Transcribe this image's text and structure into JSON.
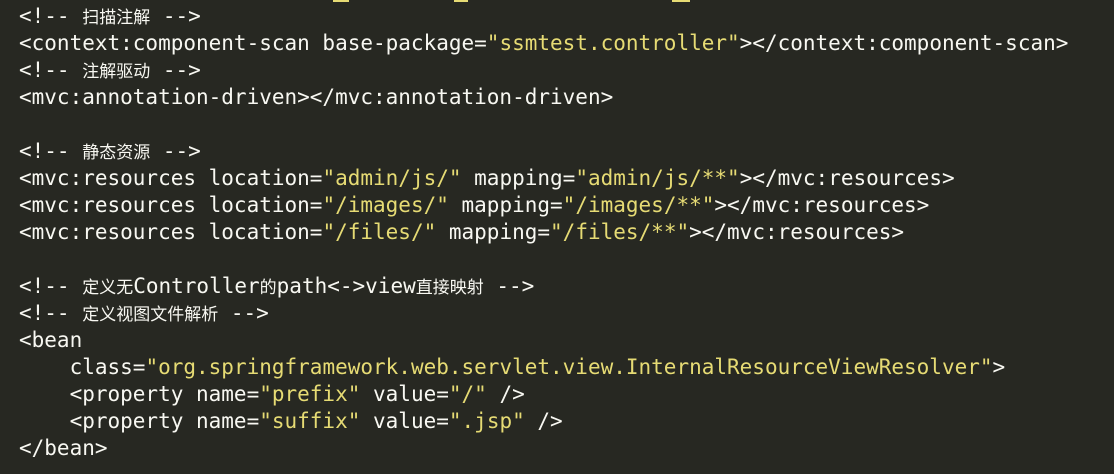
{
  "colors": {
    "background": "#272822",
    "text": "#f8f8f2",
    "string": "#e6db74"
  },
  "lines": [
    {
      "id": "l1",
      "parts": [
        {
          "t": "<!-- ",
          "k": "c"
        },
        {
          "t": "扫描注解",
          "k": "cm"
        },
        {
          "t": " -->",
          "k": "c"
        }
      ]
    },
    {
      "id": "l2",
      "parts": [
        {
          "t": "<context:component-scan base-package=",
          "k": "c"
        },
        {
          "t": "\"ssmtest.controller\"",
          "k": "s"
        },
        {
          "t": "></context:component-scan>",
          "k": "c"
        }
      ]
    },
    {
      "id": "l3",
      "parts": [
        {
          "t": "<!-- ",
          "k": "c"
        },
        {
          "t": "注解驱动",
          "k": "cm"
        },
        {
          "t": " -->",
          "k": "c"
        }
      ]
    },
    {
      "id": "l4",
      "parts": [
        {
          "t": "<mvc:annotation-driven></mvc:annotation-driven>",
          "k": "c"
        }
      ]
    },
    {
      "id": "l5",
      "parts": []
    },
    {
      "id": "l6",
      "parts": [
        {
          "t": "<!-- ",
          "k": "c"
        },
        {
          "t": "静态资源",
          "k": "cm"
        },
        {
          "t": " -->",
          "k": "c"
        }
      ]
    },
    {
      "id": "l7",
      "parts": [
        {
          "t": "<mvc:resources location=",
          "k": "c"
        },
        {
          "t": "\"admin/js/\"",
          "k": "s"
        },
        {
          "t": " mapping=",
          "k": "c"
        },
        {
          "t": "\"admin/js/**\"",
          "k": "s"
        },
        {
          "t": "></mvc:resources>",
          "k": "c"
        }
      ]
    },
    {
      "id": "l8",
      "parts": [
        {
          "t": "<mvc:resources location=",
          "k": "c"
        },
        {
          "t": "\"/images/\"",
          "k": "s"
        },
        {
          "t": " mapping=",
          "k": "c"
        },
        {
          "t": "\"/images/**\"",
          "k": "s"
        },
        {
          "t": "></mvc:resources>",
          "k": "c"
        }
      ]
    },
    {
      "id": "l9",
      "parts": [
        {
          "t": "<mvc:resources location=",
          "k": "c"
        },
        {
          "t": "\"/files/\"",
          "k": "s"
        },
        {
          "t": " mapping=",
          "k": "c"
        },
        {
          "t": "\"/files/**\"",
          "k": "s"
        },
        {
          "t": "></mvc:resources>",
          "k": "c"
        }
      ]
    },
    {
      "id": "l10",
      "parts": []
    },
    {
      "id": "l11",
      "parts": [
        {
          "t": "<!-- ",
          "k": "c"
        },
        {
          "t": "定义无",
          "k": "cm"
        },
        {
          "t": "Controller",
          "k": "c"
        },
        {
          "t": "的",
          "k": "cm"
        },
        {
          "t": "path<->view",
          "k": "c"
        },
        {
          "t": "直接映射",
          "k": "cm"
        },
        {
          "t": " -->",
          "k": "c"
        }
      ]
    },
    {
      "id": "l12",
      "parts": [
        {
          "t": "<!-- ",
          "k": "c"
        },
        {
          "t": "定义视图文件解析",
          "k": "cm"
        },
        {
          "t": " -->",
          "k": "c"
        }
      ]
    },
    {
      "id": "l13",
      "parts": [
        {
          "t": "<bean",
          "k": "c"
        }
      ]
    },
    {
      "id": "l14",
      "parts": [
        {
          "t": "    class=",
          "k": "c"
        },
        {
          "t": "\"org.springframework.web.servlet.view.InternalResourceViewResolver\"",
          "k": "s"
        },
        {
          "t": ">",
          "k": "c"
        }
      ]
    },
    {
      "id": "l15",
      "parts": [
        {
          "t": "    <property name=",
          "k": "c"
        },
        {
          "t": "\"prefix\"",
          "k": "s"
        },
        {
          "t": " value=",
          "k": "c"
        },
        {
          "t": "\"/\"",
          "k": "s"
        },
        {
          "t": " />",
          "k": "c"
        }
      ]
    },
    {
      "id": "l16",
      "parts": [
        {
          "t": "    <property name=",
          "k": "c"
        },
        {
          "t": "\"suffix\"",
          "k": "s"
        },
        {
          "t": " value=",
          "k": "c"
        },
        {
          "t": "\".jsp\"",
          "k": "s"
        },
        {
          "t": " />",
          "k": "c"
        }
      ]
    },
    {
      "id": "l17",
      "parts": [
        {
          "t": "</bean>",
          "k": "c"
        }
      ]
    }
  ]
}
